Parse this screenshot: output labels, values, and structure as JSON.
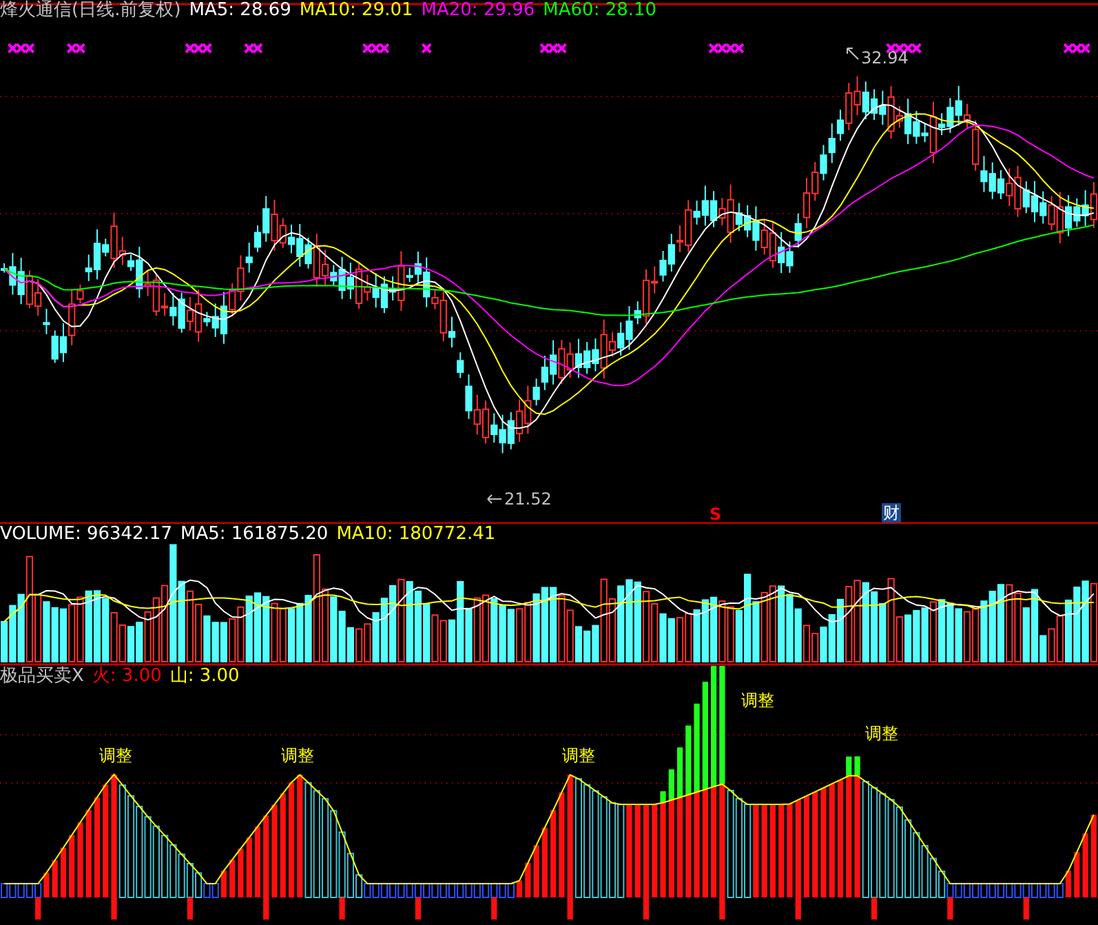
{
  "main_panel": {
    "title": "烽火通信(日线.前复权)",
    "lines": [
      {
        "text": "MA5: 28.69",
        "color": "#ffffff"
      },
      {
        "text": "MA10: 29.01",
        "color": "#ffff00"
      },
      {
        "text": "MA20: 29.96",
        "color": "#ff00ff"
      },
      {
        "text": "MA60: 28.10",
        "color": "#00ff00"
      }
    ],
    "high_label": "32.94",
    "low_label": "21.52",
    "markers": [
      {
        "text": "S",
        "kind": "signal"
      },
      {
        "text": "财",
        "kind": "finance"
      }
    ]
  },
  "volume_panel": {
    "title": "VOLUME: 96342.17",
    "lines": [
      {
        "text": "MA5: 161875.20",
        "color": "#ffffff"
      },
      {
        "text": "MA10: 180772.41",
        "color": "#ffff00"
      }
    ]
  },
  "indicator_panel": {
    "title": "极品买卖X",
    "params": [
      {
        "text": "火: 3.00",
        "color": "#ff0000"
      },
      {
        "text": "山: 3.00",
        "color": "#ffff00"
      }
    ],
    "tags": [
      "调整",
      "调整",
      "调整",
      "调整",
      "调整"
    ]
  }
}
